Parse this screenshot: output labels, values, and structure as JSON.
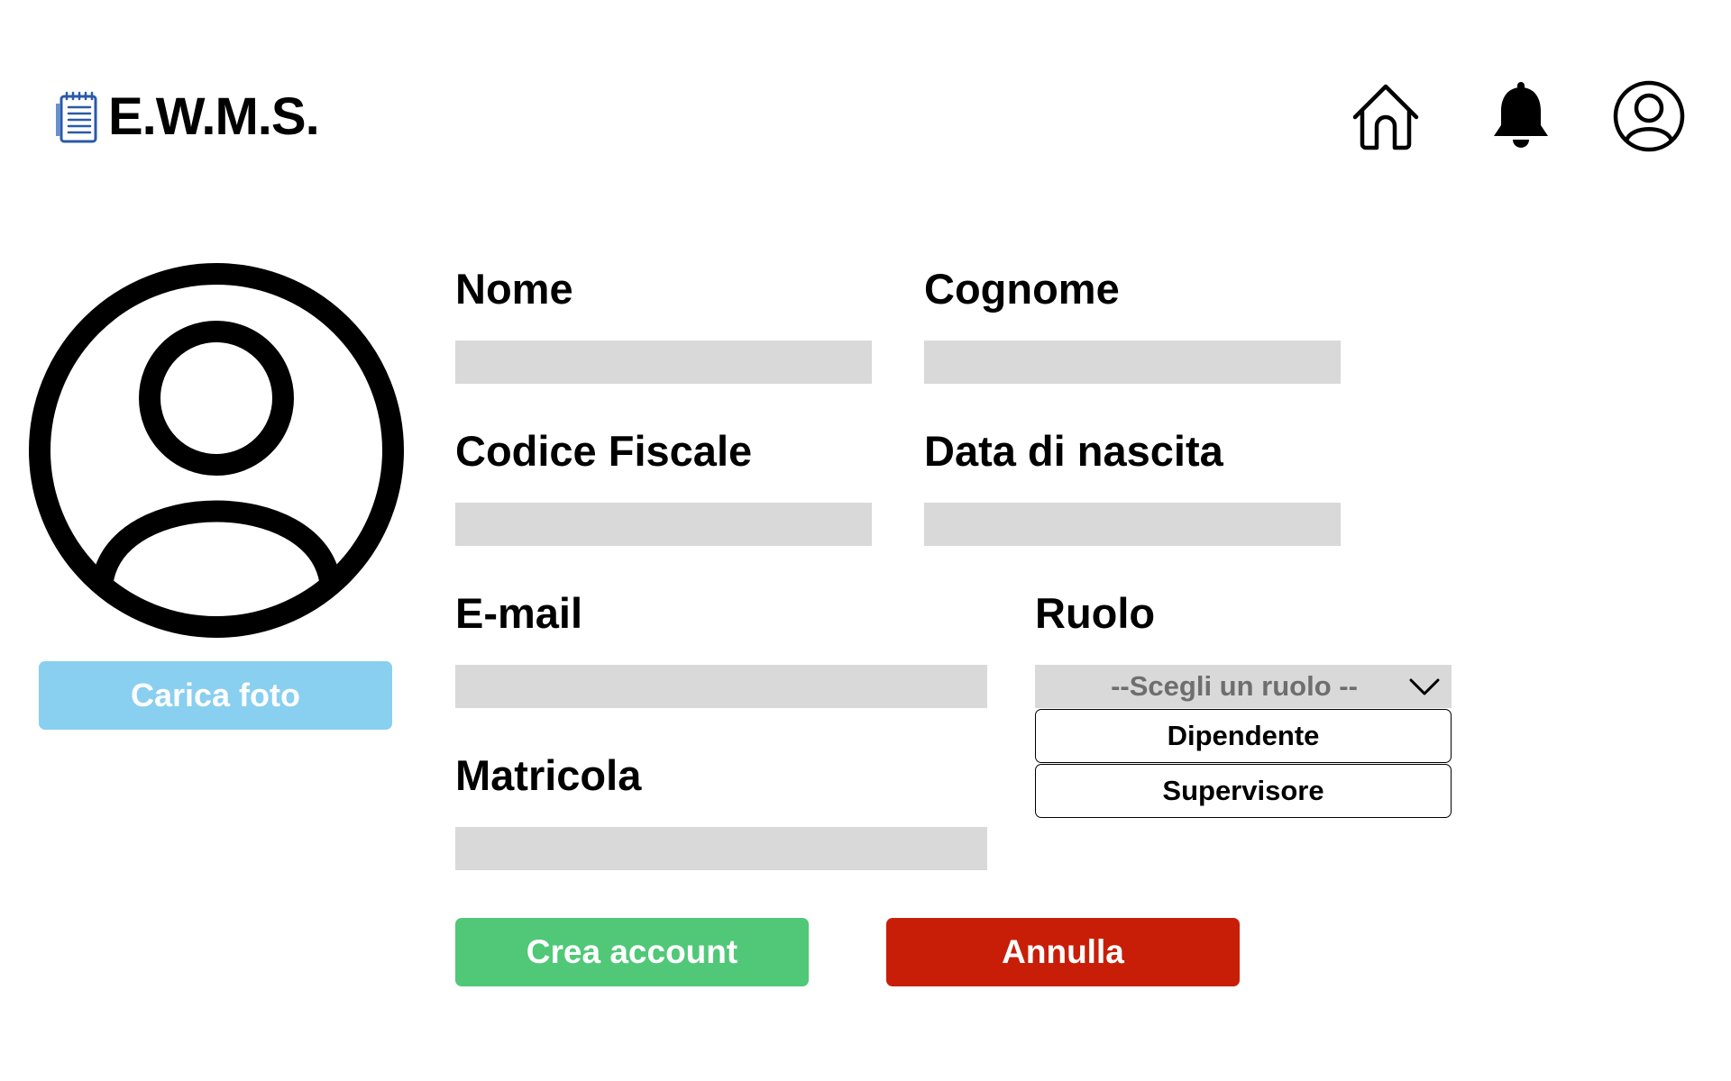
{
  "header": {
    "app_name": "E.W.M.S.",
    "logo_icon": "notepad-icon",
    "nav_icons": [
      "home-icon",
      "bell-icon",
      "account-icon"
    ]
  },
  "avatar": {
    "icon": "user-avatar-icon",
    "upload_label": "Carica foto",
    "upload_color": "#89cfef"
  },
  "form": {
    "fields": {
      "nome": {
        "label": "Nome",
        "value": ""
      },
      "cognome": {
        "label": "Cognome",
        "value": ""
      },
      "codice_fiscale": {
        "label": "Codice Fiscale",
        "value": ""
      },
      "data_nascita": {
        "label": "Data di nascita",
        "value": ""
      },
      "email": {
        "label": "E-mail",
        "value": ""
      },
      "matricola": {
        "label": "Matricola",
        "value": ""
      }
    },
    "ruolo": {
      "label": "Ruolo",
      "placeholder": "--Scegli un ruolo --",
      "options": [
        "Dipendente",
        "Supervisore"
      ],
      "expanded": true
    }
  },
  "actions": {
    "create_label": "Crea account",
    "cancel_label": "Annulla",
    "create_color": "#50c878",
    "cancel_color": "#c81e08"
  },
  "colors": {
    "field_background": "#d9d9d9"
  }
}
